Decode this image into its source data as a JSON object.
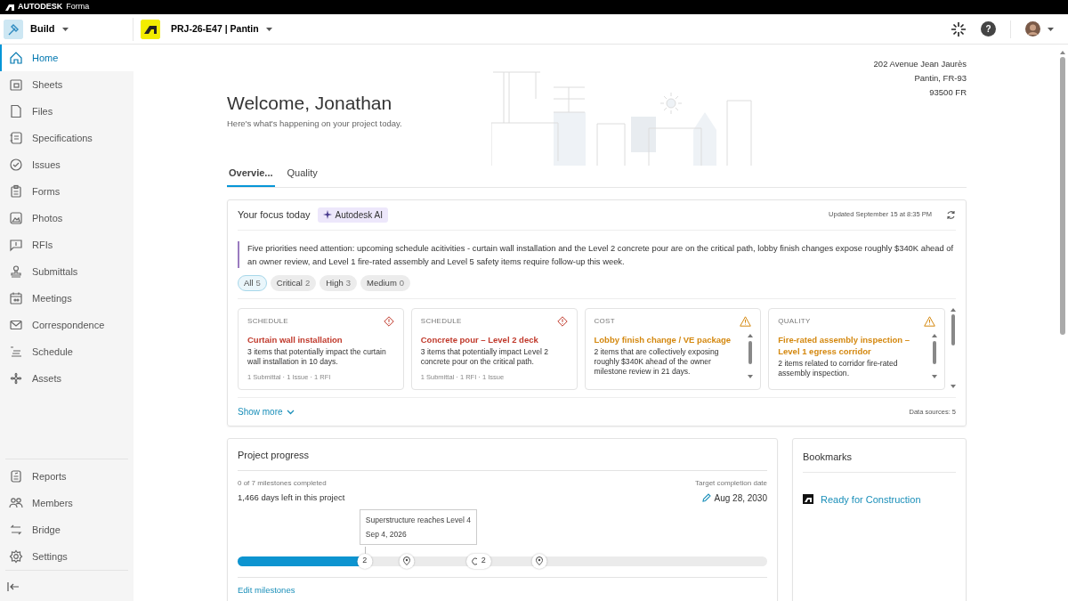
{
  "topbar": {
    "brand": "AUTODESK",
    "product": "Forma"
  },
  "header": {
    "app": "Build",
    "project": "PRJ-26-E47 | Pantin",
    "help": "?"
  },
  "sidebar": {
    "items": [
      {
        "label": "Home",
        "selected": true
      },
      {
        "label": "Sheets",
        "selected": false
      },
      {
        "label": "Files",
        "selected": false
      },
      {
        "label": "Specifications",
        "selected": false
      },
      {
        "label": "Issues",
        "selected": false
      },
      {
        "label": "Forms",
        "selected": false
      },
      {
        "label": "Photos",
        "selected": false
      },
      {
        "label": "RFIs",
        "selected": false
      },
      {
        "label": "Submittals",
        "selected": false
      },
      {
        "label": "Meetings",
        "selected": false
      },
      {
        "label": "Correspondence",
        "selected": false
      },
      {
        "label": "Schedule",
        "selected": false
      },
      {
        "label": "Assets",
        "selected": false
      }
    ],
    "bottom_items": [
      {
        "label": "Reports",
        "selected": false
      },
      {
        "label": "Members",
        "selected": false
      },
      {
        "label": "Bridge",
        "selected": false
      },
      {
        "label": "Settings",
        "selected": false
      }
    ]
  },
  "welcome": {
    "title": "Welcome, Jonathan",
    "subtitle": "Here's what's happening on your project today.",
    "address": [
      "202 Avenue Jean Jaurès",
      "Pantin, FR-93",
      "93500 FR"
    ]
  },
  "tabs": [
    {
      "label": "Overvie...",
      "selected": true
    },
    {
      "label": "Quality",
      "selected": false
    }
  ],
  "focus": {
    "title": "Your focus today",
    "ai_badge": "Autodesk AI",
    "updated": "Updated September 15 at 8:35 PM",
    "summary": "Five priorities need attention: upcoming schedule acitivities - curtain wall installation and the Level 2 concrete pour are on the critical path, lobby finish changes expose roughly $340K ahead of an owner review, and Level 1 fire-rated assembly and Level 5 safety items require follow-up this week.",
    "filters": [
      {
        "label": "All",
        "count": "5",
        "selected": true
      },
      {
        "label": "Critical",
        "count": "2",
        "selected": false
      },
      {
        "label": "High",
        "count": "3",
        "selected": false
      },
      {
        "label": "Medium",
        "count": "0",
        "selected": false
      }
    ],
    "cards": [
      {
        "category": "SCHEDULE",
        "kind": "critical",
        "color": "#c0392b",
        "title": "Curtain wall installation",
        "text": "3 items that potentially impact the curtain wall installation in 10 days.",
        "meta": "1 Submittal · 1 Issue · 1 RFI"
      },
      {
        "category": "SCHEDULE",
        "kind": "critical",
        "color": "#c0392b",
        "title": "Concrete pour – Level 2 deck",
        "text": "3 items that potentially impact Level 2 concrete pour on the critical path.",
        "meta": "1 Submittal · 1 RFI · 1 Issue"
      },
      {
        "category": "COST",
        "kind": "high",
        "color": "#d4880f",
        "title": "Lobby finish change / VE package",
        "text": "2 items that are collectively exposing roughly $340K ahead of the owner milestone review in 21 days."
      },
      {
        "category": "QUALITY",
        "kind": "high",
        "color": "#d4880f",
        "title": "Fire-rated assembly inspection – Level 1 egress corridor",
        "text": "2 items related to corridor fire-rated assembly inspection."
      }
    ],
    "show_more": "Show more",
    "sources": "Data sources: 5"
  },
  "progress": {
    "title": "Project progress",
    "milestones": "0 of 7 milestones completed",
    "days_left": "1,466 days left in this project",
    "target_label": "Target completion date",
    "target_date": "Aug 28, 2030",
    "level": 0.24,
    "markers": [
      {
        "kind": "count",
        "label": "2",
        "level": 0.24
      },
      {
        "kind": "pin",
        "level": 0.32
      },
      {
        "kind": "cluster",
        "label": "2",
        "level": 0.455
      },
      {
        "kind": "pin",
        "level": 0.57
      }
    ],
    "tooltip": {
      "title": "Superstructure reaches Level 4",
      "date": "Sep 4, 2026"
    },
    "edit": "Edit milestones"
  },
  "bookmarks": {
    "title": "Bookmarks",
    "items": [
      {
        "label": "Ready for Construction"
      }
    ]
  }
}
